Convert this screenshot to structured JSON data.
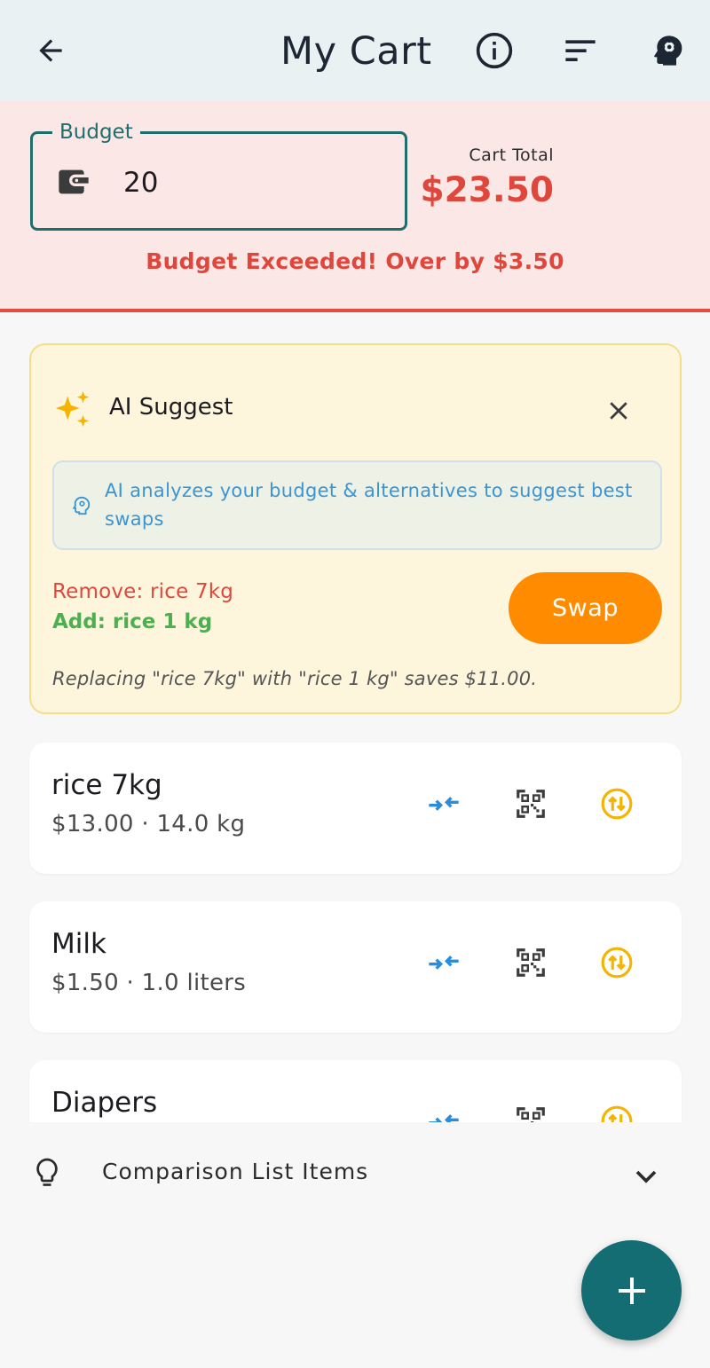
{
  "app_bar": {
    "title": "My Cart",
    "back_icon": "arrow-left-icon",
    "info_icon": "info-icon",
    "sort_icon": "sort-icon",
    "ai_icon": "head-gear-icon"
  },
  "budget": {
    "label": "Budget",
    "value": "20",
    "wallet_icon": "wallet-icon",
    "cart_total_label": "Cart Total",
    "cart_total_value": "$23.50",
    "warning": "Budget Exceeded! Over by $3.50",
    "accent_color": "#e0473c"
  },
  "ai_suggest": {
    "title": "AI Suggest",
    "info_text": "AI analyzes your budget & alternatives to suggest best swaps",
    "remove_text": "Remove: rice 7kg",
    "add_text": "Add: rice 1 kg",
    "swap_label": "Swap",
    "note": "Replacing \"rice 7kg\" with \"rice 1 kg\" saves $11.00.",
    "swap_color": "#ff8c00"
  },
  "items": [
    {
      "name": "rice 7kg",
      "meta": "$13.00 · 14.0 kg"
    },
    {
      "name": "Milk",
      "meta": "$1.50 · 1.0 liters"
    },
    {
      "name": "Diapers",
      "meta": ""
    }
  ],
  "comparison": {
    "label": "Comparison List Items"
  },
  "fab": {
    "icon": "plus-icon",
    "color": "#136d72"
  }
}
